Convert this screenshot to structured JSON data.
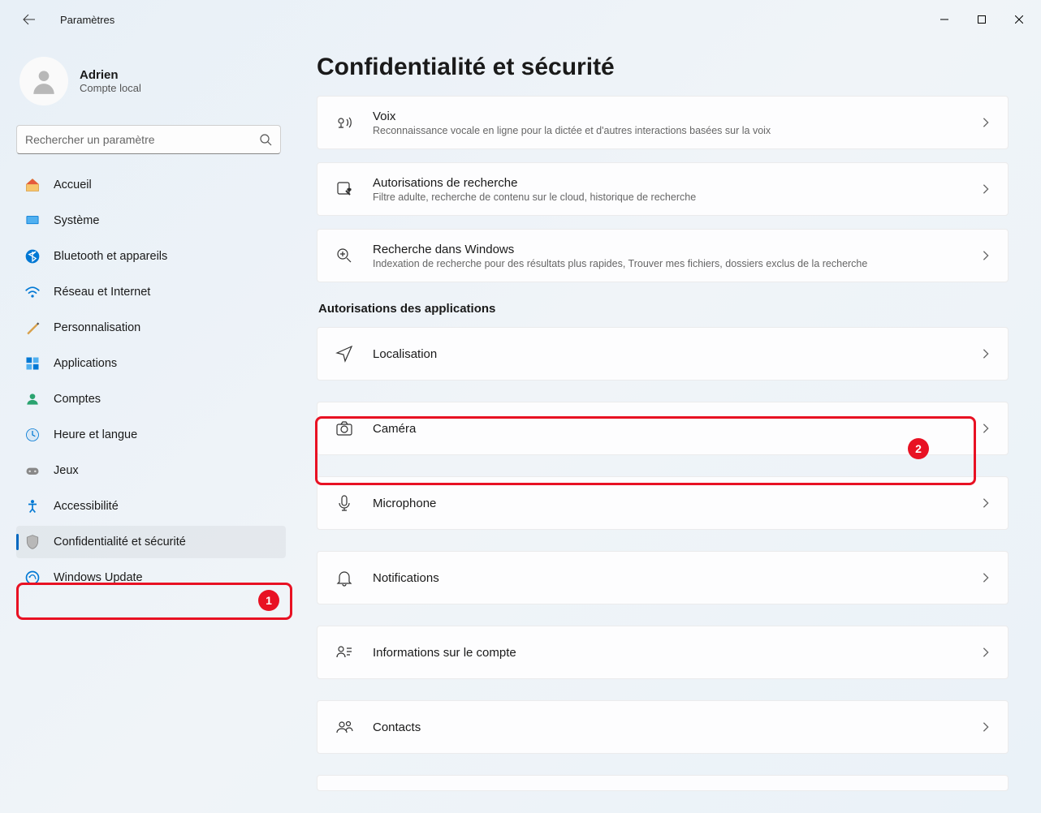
{
  "window": {
    "title": "Paramètres"
  },
  "user": {
    "name": "Adrien",
    "subtitle": "Compte local"
  },
  "search": {
    "placeholder": "Rechercher un paramètre"
  },
  "nav": {
    "items": [
      {
        "label": "Accueil"
      },
      {
        "label": "Système"
      },
      {
        "label": "Bluetooth et appareils"
      },
      {
        "label": "Réseau et Internet"
      },
      {
        "label": "Personnalisation"
      },
      {
        "label": "Applications"
      },
      {
        "label": "Comptes"
      },
      {
        "label": "Heure et langue"
      },
      {
        "label": "Jeux"
      },
      {
        "label": "Accessibilité"
      },
      {
        "label": "Confidentialité et sécurité"
      },
      {
        "label": "Windows Update"
      }
    ]
  },
  "page": {
    "title": "Confidentialité et sécurité"
  },
  "section_header": {
    "app_perms": "Autorisations des applications"
  },
  "cards": {
    "voice": {
      "title": "Voix",
      "sub": "Reconnaissance vocale en ligne pour la dictée et d'autres interactions basées sur la voix"
    },
    "search_perm": {
      "title": "Autorisations de recherche",
      "sub": "Filtre adulte, recherche de contenu sur le cloud, historique de recherche"
    },
    "search_win": {
      "title": "Recherche dans Windows",
      "sub": "Indexation de recherche pour des résultats plus rapides, Trouver mes fichiers, dossiers exclus de la recherche"
    },
    "location": {
      "title": "Localisation"
    },
    "camera": {
      "title": "Caméra"
    },
    "microphone": {
      "title": "Microphone"
    },
    "notifications": {
      "title": "Notifications"
    },
    "account_info": {
      "title": "Informations sur le compte"
    },
    "contacts": {
      "title": "Contacts"
    }
  },
  "annotations": {
    "badge1": "1",
    "badge2": "2"
  }
}
